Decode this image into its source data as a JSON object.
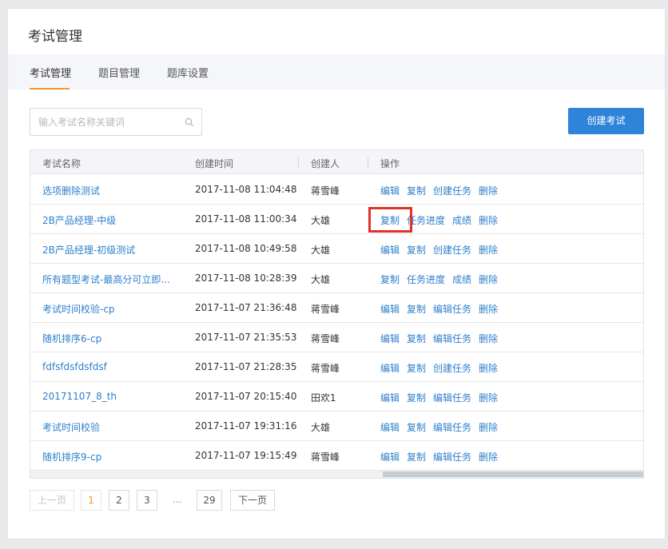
{
  "page": {
    "title": "考试管理"
  },
  "tabs": [
    {
      "label": "考试管理",
      "active": true
    },
    {
      "label": "题目管理",
      "active": false
    },
    {
      "label": "题库设置",
      "active": false
    }
  ],
  "search": {
    "placeholder": "输入考试名称关键词",
    "icon": "search-icon"
  },
  "create_button": {
    "label": "创建考试"
  },
  "table": {
    "headers": {
      "name": "考试名称",
      "time": "创建时间",
      "creator": "创建人",
      "ops": "操作"
    },
    "rows": [
      {
        "name": "选项删除测试",
        "time": "2017-11-08 11:04:48",
        "creator": "蒋雪峰",
        "ops": [
          "编辑",
          "复制",
          "创建任务",
          "删除"
        ]
      },
      {
        "name": "2B产品经理-中级",
        "time": "2017-11-08 11:00:34",
        "creator": "大雄",
        "ops": [
          "复制",
          "任务进度",
          "成绩",
          "删除"
        ]
      },
      {
        "name": "2B产品经理-初级测试",
        "time": "2017-11-08 10:49:58",
        "creator": "大雄",
        "ops": [
          "编辑",
          "复制",
          "创建任务",
          "删除"
        ]
      },
      {
        "name": "所有题型考试-最高分可立即...",
        "time": "2017-11-08 10:28:39",
        "creator": "大雄",
        "ops": [
          "复制",
          "任务进度",
          "成绩",
          "删除"
        ]
      },
      {
        "name": "考试时间校验-cp",
        "time": "2017-11-07 21:36:48",
        "creator": "蒋雪峰",
        "ops": [
          "编辑",
          "复制",
          "编辑任务",
          "删除"
        ]
      },
      {
        "name": "随机排序6-cp",
        "time": "2017-11-07 21:35:53",
        "creator": "蒋雪峰",
        "ops": [
          "编辑",
          "复制",
          "编辑任务",
          "删除"
        ]
      },
      {
        "name": "fdfsfdsfdsfdsf",
        "time": "2017-11-07 21:28:35",
        "creator": "蒋雪峰",
        "ops": [
          "编辑",
          "复制",
          "创建任务",
          "删除"
        ]
      },
      {
        "name": "20171107_8_th",
        "time": "2017-11-07 20:15:40",
        "creator": "田欢1",
        "ops": [
          "编辑",
          "复制",
          "编辑任务",
          "删除"
        ]
      },
      {
        "name": "考试时间校验",
        "time": "2017-11-07 19:31:16",
        "creator": "大雄",
        "ops": [
          "编辑",
          "复制",
          "编辑任务",
          "删除"
        ]
      },
      {
        "name": "随机排序9-cp",
        "time": "2017-11-07 19:15:49",
        "creator": "蒋雪峰",
        "ops": [
          "编辑",
          "复制",
          "编辑任务",
          "删除"
        ]
      }
    ]
  },
  "pagination": {
    "prev": "上一页",
    "pages": [
      "1",
      "2",
      "3"
    ],
    "current": "1",
    "ellipsis": "...",
    "last": "29",
    "next": "下一页"
  },
  "colors": {
    "accent": "#2d84d8",
    "link": "#2d7fcc",
    "tab_active": "#f39a2a",
    "highlight": "#e0322b"
  }
}
